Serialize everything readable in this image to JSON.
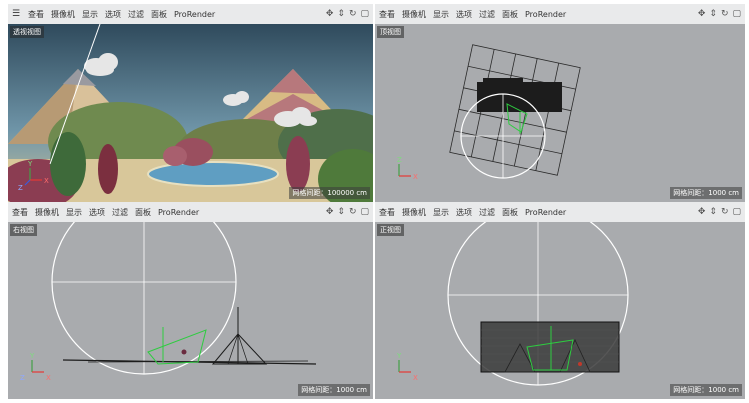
{
  "menu": [
    "查看",
    "摄像机",
    "显示",
    "选项",
    "过滤",
    "面板",
    "ProRender"
  ],
  "viewports": {
    "perspective": {
      "label": "透视视图",
      "grid": "网格间距：100000 cm"
    },
    "top": {
      "label": "顶视图",
      "grid": "网格间距：1000 cm"
    },
    "right": {
      "label": "右视图",
      "grid": "网格间距：1000 cm"
    },
    "front": {
      "label": "正视图",
      "grid": "网格间距：1000 cm"
    }
  },
  "axis": {
    "x": "X",
    "y": "Y",
    "z": "Z"
  },
  "colors": {
    "viewport_bg": "#a9abae",
    "menubar_bg": "#e9eaeb",
    "accent_green": "#2ecc40",
    "axis_x": "#e53935",
    "axis_y": "#43a047",
    "axis_z": "#3b5bdb"
  },
  "icons": [
    "menu-icon",
    "move-icon",
    "zoom-icon",
    "rotate-icon",
    "maximize-icon"
  ]
}
